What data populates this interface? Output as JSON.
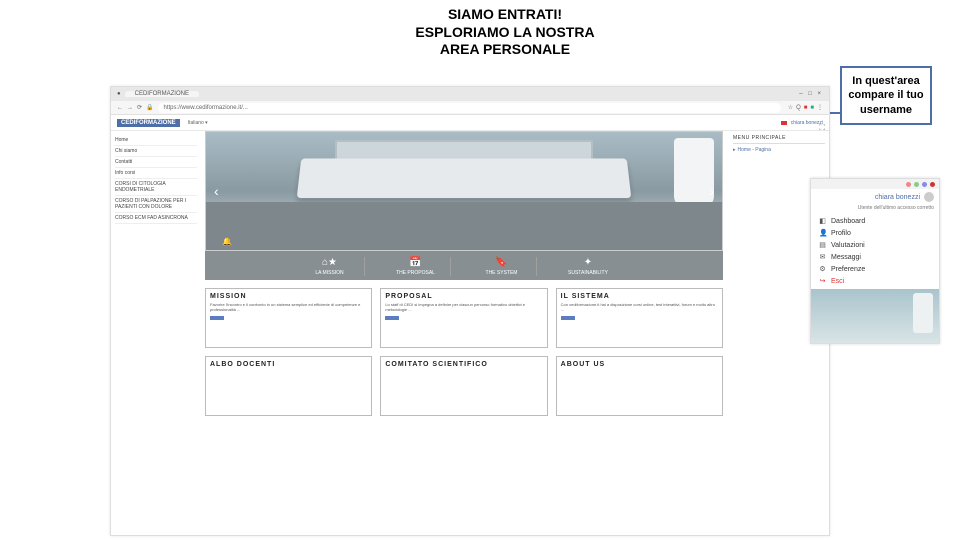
{
  "title": {
    "line1": "SIAMO ENTRATI!",
    "line2": "ESPLORIAMO LA NOSTRA",
    "line3": "AREA PERSONALE"
  },
  "callout": "In quest'area compare il tuo username",
  "browser": {
    "tab_label": "CEDIFORMAZIONE",
    "url": "https://www.cediformazione.it/...",
    "logo": "CEDIFORMAZIONE",
    "lang": "Italiano ▾",
    "username_top": "chiara bonezzi"
  },
  "sidebar": {
    "items": [
      "Home",
      "Chi siamo",
      "Contatti",
      "Info corsi",
      "CORSI DI CITOLOGIA ENDOMETRIALE",
      "CORSO DI PALPAZIONE PER I PAZIENTI CON DOLORE",
      "CORSO ECM FAD ASINCRONA"
    ]
  },
  "navgrid": [
    {
      "icon": "⌂★",
      "label": "LA MISSION"
    },
    {
      "icon": "📅",
      "label": "THE PROPOSAL"
    },
    {
      "icon": "🔖",
      "label": "THE SYSTEM"
    },
    {
      "icon": "✦",
      "label": "SUSTAINABILITY"
    }
  ],
  "right_panel": {
    "title": "MENU PRINCIPALE",
    "link": "Home - Pagina"
  },
  "cards_row1": [
    {
      "heading": "MISSION",
      "text": "Favorire l'incontro e il confronto in un sistema semplice ed efficiente di competenze e professionalità ..."
    },
    {
      "heading": "PROPOSAL",
      "text": "Lo staff di CEDI si impegna a definire per ciascun percorso formativo obiettivi e metodologie ..."
    },
    {
      "heading": "IL SISTEMA",
      "text": "Con cediformazione.it hai a disposizione corsi online, test interattivi, forum e molto altro ..."
    }
  ],
  "cards_row2": [
    {
      "heading": "ALBO DOCENTI"
    },
    {
      "heading": "COMITATO SCIENTIFICO"
    },
    {
      "heading": "ABOUT US"
    }
  ],
  "snippet": {
    "username": "chiara bonezzi",
    "status": "Utente dell'ultimo accesso corretto",
    "menu": [
      {
        "icon": "◧",
        "label": "Dashboard"
      },
      {
        "icon": "👤",
        "label": "Profilo"
      },
      {
        "icon": "▤",
        "label": "Valutazioni"
      },
      {
        "icon": "✉",
        "label": "Messaggi"
      },
      {
        "icon": "⚙",
        "label": "Preferenze"
      },
      {
        "icon": "↪",
        "label": "Esci"
      }
    ]
  }
}
